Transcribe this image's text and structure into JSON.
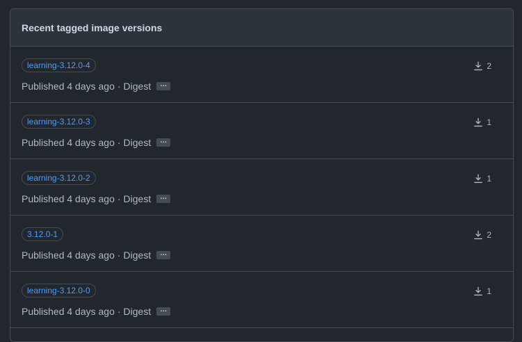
{
  "header": {
    "title": "Recent tagged image versions"
  },
  "versions": [
    {
      "tag": "learning-3.12.0-4",
      "published": "Published 4 days ago",
      "separator": "·",
      "digest_label": "Digest",
      "downloads": "2"
    },
    {
      "tag": "learning-3.12.0-3",
      "published": "Published 4 days ago",
      "separator": "·",
      "digest_label": "Digest",
      "downloads": "1"
    },
    {
      "tag": "learning-3.12.0-2",
      "published": "Published 4 days ago",
      "separator": "·",
      "digest_label": "Digest",
      "downloads": "1"
    },
    {
      "tag": "3.12.0-1",
      "published": "Published 4 days ago",
      "separator": "·",
      "digest_label": "Digest",
      "downloads": "2"
    },
    {
      "tag": "learning-3.12.0-0",
      "published": "Published 4 days ago",
      "separator": "·",
      "digest_label": "Digest",
      "downloads": "1"
    }
  ],
  "icons": {
    "download": "download-icon",
    "ellipsis": "…"
  },
  "colors": {
    "background": "#22272e",
    "header_background": "#2d333b",
    "border": "#444c56",
    "tag_text": "#539bf5",
    "muted_text": "#adbac7"
  }
}
